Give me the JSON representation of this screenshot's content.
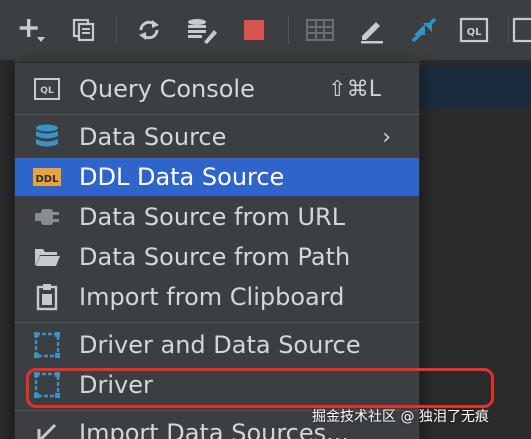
{
  "toolbar": {
    "buttons": [
      "add-icon",
      "duplicate-icon",
      "refresh-icon",
      "properties-icon",
      "stop-icon",
      "table-icon",
      "edit-icon",
      "jump-icon",
      "console-icon"
    ],
    "ql_label": "QL"
  },
  "menu": {
    "items": [
      {
        "label": "Query Console",
        "shortcut": "⇧⌘L",
        "icon": "console-icon",
        "icon_text": "QL"
      },
      {
        "label": "Data Source",
        "arrow": "›",
        "icon": "database-icon"
      },
      {
        "label": "DDL Data Source",
        "icon": "ddl-icon",
        "icon_text": "DDL",
        "selected": true
      },
      {
        "label": "Data Source from URL",
        "icon": "plug-icon"
      },
      {
        "label": "Data Source from Path",
        "icon": "folder-icon"
      },
      {
        "label": "Import from Clipboard",
        "icon": "clipboard-icon"
      },
      {
        "label": "Driver and Data Source",
        "icon": "driver-icon"
      },
      {
        "label": "Driver",
        "icon": "driver-icon"
      },
      {
        "label": "Import Data Sources...",
        "icon": "import-icon"
      }
    ]
  },
  "watermark": "掘金技术社区 @ 独泪了无痕",
  "colors": {
    "menu_bg": "#3c3f41",
    "selected": "#2f65ca",
    "highlight": "#e8302a",
    "stop": "#d9534f",
    "accent_blue": "#3592c4"
  }
}
